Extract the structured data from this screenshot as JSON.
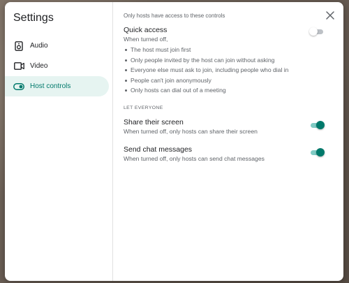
{
  "sidebar": {
    "title": "Settings",
    "items": [
      {
        "label": "Audio",
        "icon": "speaker-icon"
      },
      {
        "label": "Video",
        "icon": "video-camera-icon"
      },
      {
        "label": "Host controls",
        "icon": "toggle-icon",
        "active": true
      }
    ]
  },
  "main": {
    "header_note": "Only hosts have access to these controls",
    "quick_access": {
      "title": "Quick access",
      "desc": "When turned off,",
      "bullets": [
        "The host must join first",
        "Only people invited by the host can join without asking",
        "Everyone else must ask to join, including people who dial in",
        "People can't join anonymously",
        "Only hosts can dial out of a meeting"
      ],
      "enabled": false
    },
    "section_label": "LET EVERYONE",
    "share_screen": {
      "title": "Share their screen",
      "desc": "When turned off, only hosts can share their screen",
      "enabled": true
    },
    "chat": {
      "title": "Send chat messages",
      "desc": "When turned off, only hosts can send chat messages",
      "enabled": true
    }
  },
  "colors": {
    "accent": "#00796b",
    "accent_light": "#80cbc4",
    "active_bg": "#e6f4f1"
  }
}
